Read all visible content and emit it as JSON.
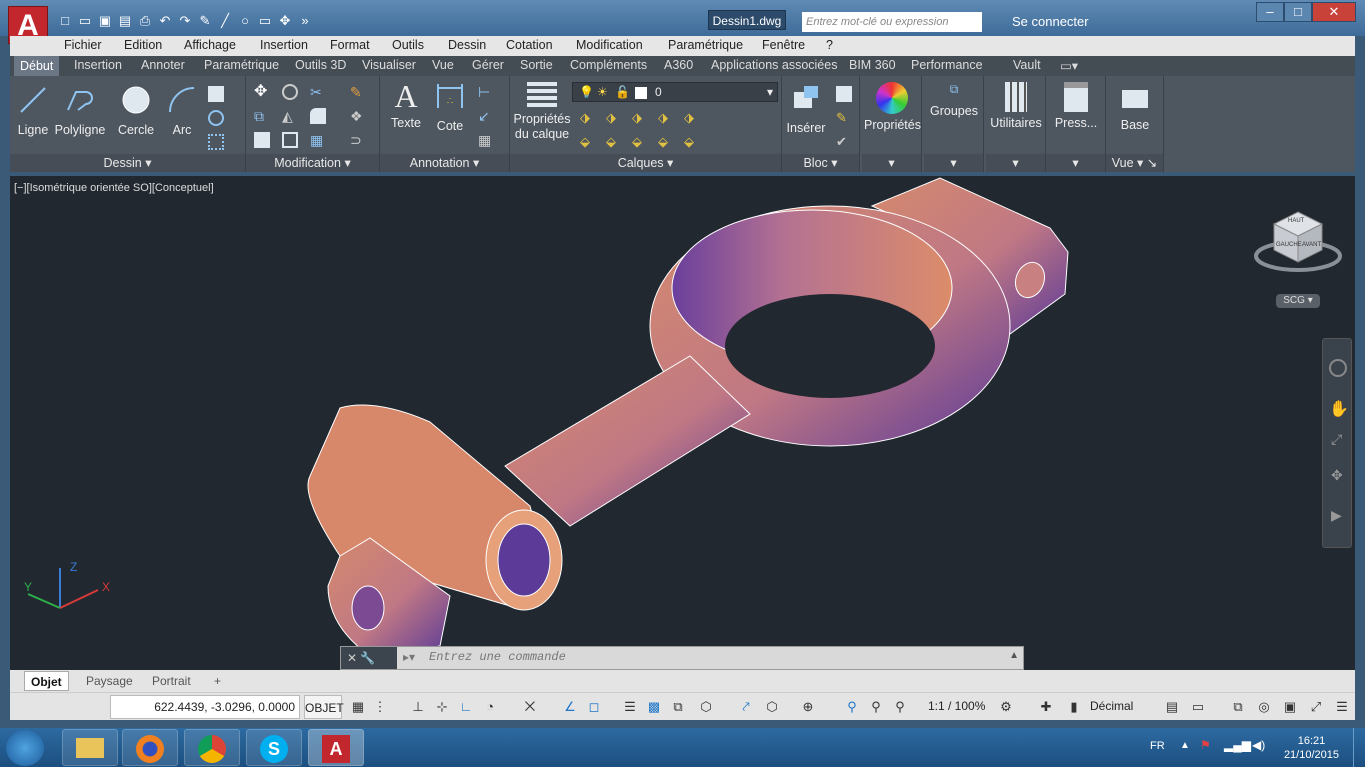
{
  "title_bar": {
    "doc_title": "Dessin1.dwg",
    "search_placeholder": "Entrez mot-clé ou expression",
    "signin": "Se connecter",
    "app_letter": "A"
  },
  "menu": [
    "Fichier",
    "Edition",
    "Affichage",
    "Insertion",
    "Format",
    "Outils",
    "Dessin",
    "Cotation",
    "Modification",
    "Paramétrique",
    "Fenêtre",
    "?"
  ],
  "ribbon_tabs": [
    "Début",
    "Insertion",
    "Annoter",
    "Paramétrique",
    "Outils 3D",
    "Visualiser",
    "Vue",
    "Gérer",
    "Sortie",
    "Compléments",
    "A360",
    "Applications associées",
    "BIM 360",
    "Performance",
    "Vault"
  ],
  "ribbon": {
    "dessin": {
      "label": "Dessin",
      "tools": [
        "Ligne",
        "Polyligne",
        "Cercle",
        "Arc"
      ]
    },
    "modification": {
      "label": "Modification"
    },
    "annotation": {
      "label": "Annotation",
      "tools": [
        "Texte",
        "Cote"
      ]
    },
    "calques": {
      "label": "Calques",
      "tool": "Propriétés du calque",
      "tool_line1": "Propriétés",
      "tool_line2": "du calque",
      "layer_value": "0"
    },
    "bloc": {
      "label": "Bloc",
      "tool": "Insérer"
    },
    "proprietes": {
      "label": "Propriétés"
    },
    "groupes": {
      "label": "Groupes"
    },
    "utilitaires": {
      "label": "Utilitaires"
    },
    "presse": {
      "label": "Press..."
    },
    "vue": {
      "label": "Vue",
      "tool": "Base"
    }
  },
  "viewport": {
    "label": "[−][Isométrique orientée SO][Conceptuel]",
    "ucs_x": "X",
    "ucs_y": "Y",
    "ucs_z": "Z",
    "viewcube_top": "HAUT",
    "viewcube_left": "GAUCHE",
    "viewcube_right": "AVANT",
    "wcs_label": "SCG"
  },
  "command": {
    "placeholder": "Entrez une commande"
  },
  "layout_tabs": [
    "Objet",
    "Paysage",
    "Portrait"
  ],
  "status": {
    "coords": "622.4439, -3.0296, 0.0000",
    "mode": "OBJET",
    "scale": "1:1 / 100%",
    "units": "Décimal"
  },
  "taskbar": {
    "lang": "FR",
    "time": "16:21",
    "date": "21/10/2015"
  },
  "colors": {
    "accent": "#c1272d",
    "viewport_bg": "#212830",
    "model_top": "#d9876a",
    "model_shade": "#6b3f9a"
  }
}
